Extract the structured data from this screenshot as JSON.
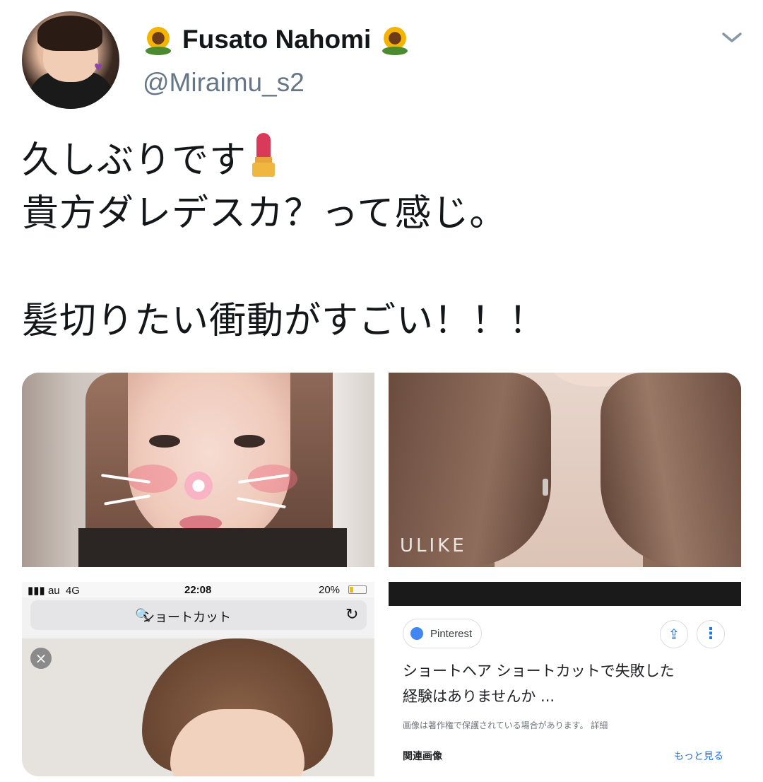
{
  "author": {
    "display_name": "Fusato Nahomi",
    "handle": "@Miraimu_s2",
    "name_emoji_left": "sunflower-icon",
    "name_emoji_right": "sunflower-icon"
  },
  "tweet": {
    "lines": [
      "久しぶりです",
      "貴方ダレデスカ？って感じ。",
      "",
      "髪切りたい衝動がすごい！！！"
    ],
    "line1_emoji": "lipstick-icon"
  },
  "media": {
    "tile2_watermark": "ULIKE",
    "tile3": {
      "carrier": "au",
      "network": "4G",
      "time": "22:08",
      "battery": "20%",
      "address": "ショートカット"
    },
    "tile4": {
      "source": "Pinterest",
      "title_line1": "ショートヘア ショートカットで失敗した",
      "title_line2": "経験はありませんか ...",
      "copyright": "画像は著作権で保護されている場合があります。 詳細",
      "related": "関連画像",
      "see_more": "もっと見る"
    }
  },
  "colors": {
    "text_primary": "#14171a",
    "text_secondary": "#657786",
    "link_blue": "#1a73e8"
  }
}
